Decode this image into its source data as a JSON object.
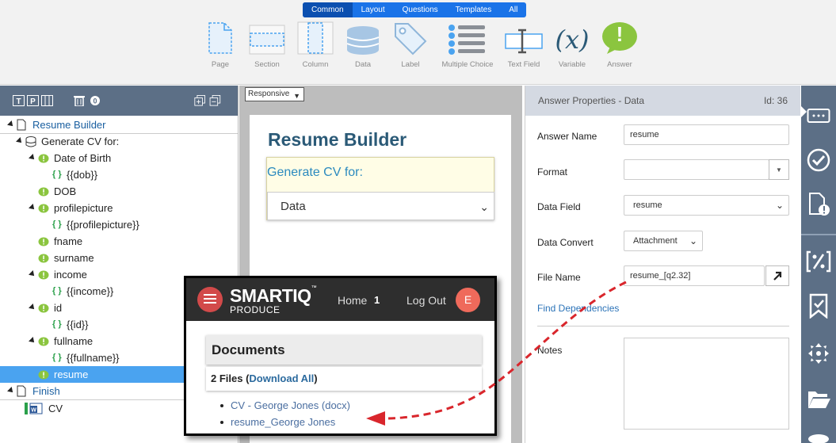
{
  "toolbar": {
    "tabs": [
      "Common",
      "Layout",
      "Questions",
      "Templates",
      "All"
    ],
    "tools": [
      {
        "label": "Page",
        "icon": "page-icon"
      },
      {
        "label": "Section",
        "icon": "section-icon"
      },
      {
        "label": "Column",
        "icon": "column-icon"
      },
      {
        "label": "Data",
        "icon": "database-icon"
      },
      {
        "label": "Label",
        "icon": "tag-icon"
      },
      {
        "label": "Multiple Choice",
        "icon": "list-icon"
      },
      {
        "label": "Text Field",
        "icon": "text-field-icon"
      },
      {
        "label": "Variable",
        "icon": "variable-icon",
        "glyph": "(x)"
      },
      {
        "label": "Answer",
        "icon": "answer-bubble-icon",
        "glyph": "!"
      }
    ]
  },
  "tree": {
    "items": [
      {
        "label": "Resume Builder",
        "icon": "page-icon"
      },
      {
        "label": "Generate CV for:",
        "icon": "database-icon"
      },
      {
        "label": "Date of Birth",
        "icon": "answer-icon"
      },
      {
        "label": "{{dob}}",
        "icon": "braces-icon"
      },
      {
        "label": "DOB",
        "icon": "answer-icon"
      },
      {
        "label": "profilepicture",
        "icon": "answer-icon"
      },
      {
        "label": "{{profilepicture}}",
        "icon": "braces-icon"
      },
      {
        "label": "fname",
        "icon": "answer-icon"
      },
      {
        "label": "surname",
        "icon": "answer-icon"
      },
      {
        "label": "income",
        "icon": "answer-icon"
      },
      {
        "label": "{{income}}",
        "icon": "braces-icon"
      },
      {
        "label": "id",
        "icon": "answer-icon"
      },
      {
        "label": "{{id}}",
        "icon": "braces-icon"
      },
      {
        "label": "fullname",
        "icon": "answer-icon"
      },
      {
        "label": "{{fullname}}",
        "icon": "braces-icon"
      },
      {
        "label": "resume",
        "icon": "answer-icon",
        "selected": true
      },
      {
        "label": "Finish",
        "icon": "page-icon"
      },
      {
        "label": "CV",
        "icon": "word-doc-icon"
      }
    ],
    "braces": "{ }"
  },
  "canvas": {
    "responsive_value": "Responsive",
    "page_title": "Resume Builder",
    "question_label": "Generate CV for:",
    "question_value": "Data"
  },
  "properties": {
    "title": "Answer Properties - Data",
    "id_label": "Id: 36",
    "answer_name_label": "Answer Name",
    "answer_name_value": "resume",
    "format_label": "Format",
    "format_value": "",
    "data_field_label": "Data Field",
    "data_field_value": "resume",
    "data_convert_label": "Data Convert",
    "data_convert_value": "Attachment",
    "file_name_label": "File Name",
    "file_name_value": "resume_[q2.32]",
    "find_dependencies": "Find Dependencies",
    "notes_label": "Notes"
  },
  "overlay": {
    "brand": "SMART",
    "brand_accent": "IQ",
    "brand_tm": "™",
    "sub": "PRODUCE",
    "home": "Home",
    "home_count": "1",
    "logout": "Log Out",
    "avatar": "E",
    "documents_title": "Documents",
    "files_count": "2 Files",
    "download_all": "Download All",
    "files": [
      "CV - George Jones (docx)",
      "resume_George Jones"
    ]
  },
  "colors": {
    "accent": "#1a73e8",
    "header_slate": "#5c6f86",
    "selected_row": "#4aa3f0",
    "title_text": "#2b5a77",
    "arrow_red": "#d9262c"
  }
}
